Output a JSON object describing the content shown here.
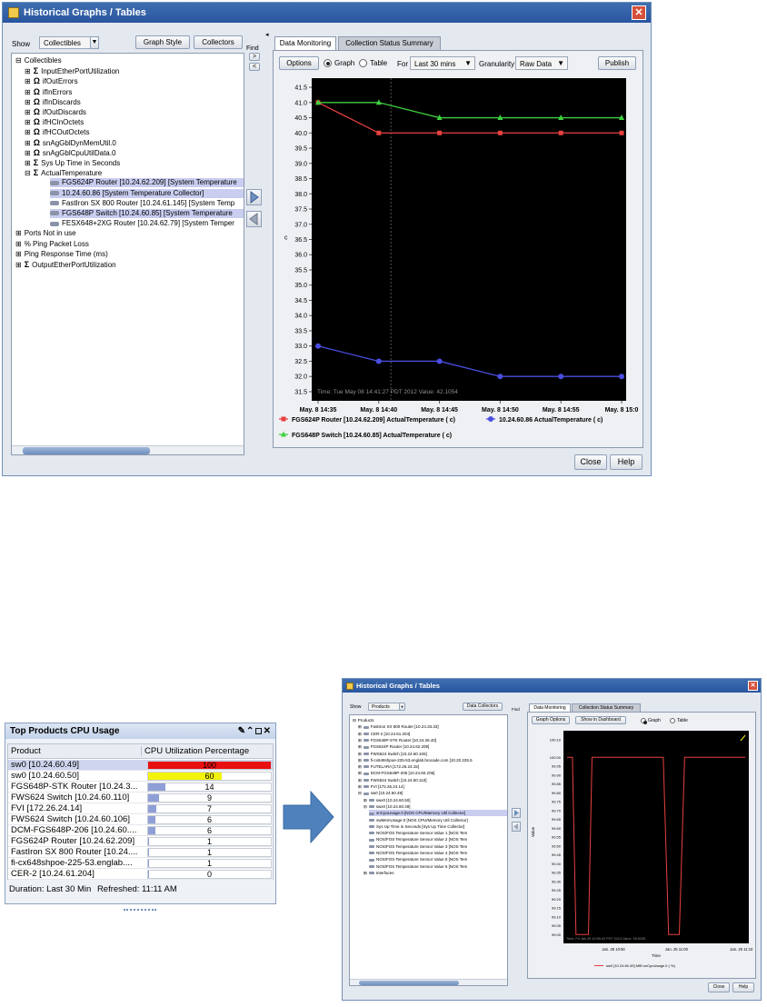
{
  "main_window": {
    "title": "Historical Graphs / Tables",
    "show_label": "Show",
    "show_value": "Collectibles",
    "graph_style_label": "Graph Style",
    "collectors_label": "Collectors",
    "find_label": "Find",
    "tree": [
      {
        "depth": 0,
        "exp": "⊟",
        "icon": "",
        "label": "Collectibles",
        "selected": false
      },
      {
        "depth": 1,
        "exp": "⊞",
        "icon": "Σ",
        "label": "InputEtherPortUtilization",
        "selected": false
      },
      {
        "depth": 1,
        "exp": "⊞",
        "icon": "Ω",
        "label": "ifOutErrors",
        "selected": false
      },
      {
        "depth": 1,
        "exp": "⊞",
        "icon": "Ω",
        "label": "ifInErrors",
        "selected": false
      },
      {
        "depth": 1,
        "exp": "⊞",
        "icon": "Ω",
        "label": "ifInDiscards",
        "selected": false
      },
      {
        "depth": 1,
        "exp": "⊞",
        "icon": "Ω",
        "label": "ifOutDiscards",
        "selected": false
      },
      {
        "depth": 1,
        "exp": "⊞",
        "icon": "Ω",
        "label": "ifHCInOctets",
        "selected": false
      },
      {
        "depth": 1,
        "exp": "⊞",
        "icon": "Ω",
        "label": "ifHCOutOctets",
        "selected": false
      },
      {
        "depth": 1,
        "exp": "⊞",
        "icon": "Ω",
        "label": "snAgGblDynMemUtil.0",
        "selected": false
      },
      {
        "depth": 1,
        "exp": "⊞",
        "icon": "Ω",
        "label": "snAgGblCpuUtilData.0",
        "selected": false
      },
      {
        "depth": 1,
        "exp": "⊞",
        "icon": "Σ",
        "label": "Sys Up Time in Seconds",
        "selected": false
      },
      {
        "depth": 1,
        "exp": "⊟",
        "icon": "Σ",
        "label": "ActualTemperature",
        "selected": false
      },
      {
        "depth": 2,
        "exp": "",
        "icon": "dev",
        "label": "FGS624P Router [10.24.62.209] [System Temperature",
        "selected": true
      },
      {
        "depth": 2,
        "exp": "",
        "icon": "dev",
        "label": "10.24.60.86 [System Temperature Collector]",
        "selected": true
      },
      {
        "depth": 2,
        "exp": "",
        "icon": "dev",
        "label": "FastIron SX 800 Router [10.24.61.145] [System Temp",
        "selected": false
      },
      {
        "depth": 2,
        "exp": "",
        "icon": "dev",
        "label": "FGS648P Switch [10.24.60.85] [System Temperature",
        "selected": true
      },
      {
        "depth": 2,
        "exp": "",
        "icon": "dev",
        "label": "FESX648+2XG Router [10.24.62.79] [System Temper",
        "selected": false
      },
      {
        "depth": 0,
        "exp": "⊞",
        "icon": "",
        "label": "Ports Not in use",
        "selected": false
      },
      {
        "depth": 0,
        "exp": "⊞",
        "icon": "",
        "label": "% Ping Packet Loss",
        "selected": false
      },
      {
        "depth": 0,
        "exp": "⊞",
        "icon": "",
        "label": "Ping Response Time (ms)",
        "selected": false
      },
      {
        "depth": 0,
        "exp": "⊞",
        "icon": "Σ",
        "label": "OutputEtherPortUtilization",
        "selected": false
      }
    ],
    "tabs": [
      "Data Monitoring",
      "Collection Status Summary"
    ],
    "options_label": "Options",
    "graph_label": "Graph",
    "table_label": "Table",
    "for_label": "For",
    "for_value": "Last 30 mins",
    "granularity_label": "Granularity",
    "granularity_value": "Raw Data",
    "publish_label": "Publish",
    "tooltip": "Time: Tue May 08 14:41:27 PDT 2012 Value: 42.1054",
    "close_label": "Close",
    "help_label": "Help"
  },
  "chart_data": [
    {
      "type": "line",
      "ylabel": "c",
      "ylim": [
        31.2,
        41.8
      ],
      "yticks": [
        "41.5",
        "41.0",
        "40.5",
        "40.0",
        "39.5",
        "39.0",
        "38.5",
        "38.0",
        "37.5",
        "37.0",
        "36.5",
        "36.0",
        "35.5",
        "35.0",
        "34.5",
        "34.0",
        "33.5",
        "33.0",
        "32.5",
        "32.0",
        "31.5"
      ],
      "categories": [
        "May. 8 14:35",
        "May. 8 14:40",
        "May. 8 14:45",
        "May. 8 14:50",
        "May. 8 14:55",
        "May. 8 15:0"
      ],
      "x": [
        0,
        1,
        2,
        3,
        4,
        5
      ],
      "grid": false,
      "legend_position": "bottom",
      "series": [
        {
          "name": "FGS624P Router [10.24.62.209] ActualTemperature ( c)",
          "color": "#e84040",
          "marker": "square",
          "values": [
            41.0,
            40.0,
            40.0,
            40.0,
            40.0,
            40.0
          ]
        },
        {
          "name": "10.24.60.86 ActualTemperature ( c)",
          "color": "#4a4ee0",
          "marker": "circle",
          "values": [
            33.0,
            32.5,
            32.5,
            32.0,
            32.0,
            32.0
          ]
        },
        {
          "name": "FGS648P Switch [10.24.60.85] ActualTemperature ( c)",
          "color": "#3fd040",
          "marker": "triangle",
          "values": [
            41.0,
            41.0,
            40.5,
            40.5,
            40.5,
            40.5
          ]
        }
      ]
    },
    {
      "type": "table",
      "title": "Top Products CPU Usage",
      "columns": [
        "Product",
        "CPU Utilization Percentage"
      ],
      "rows": [
        {
          "product": "sw0 [10.24.60.49]",
          "value": 100,
          "color": "#e81010"
        },
        {
          "product": "sw0 [10.24.60.50]",
          "value": 60,
          "color": "#f2f20a"
        },
        {
          "product": "FGS648P-STK Router [10.24.3...",
          "value": 14,
          "color": "#8f9fd6"
        },
        {
          "product": "FWS624 Switch [10.24.60.110]",
          "value": 9,
          "color": "#8f9fd6"
        },
        {
          "product": "FVI [172.26.24.14]",
          "value": 7,
          "color": "#8f9fd6"
        },
        {
          "product": "FWS624 Switch [10.24.60.106]",
          "value": 6,
          "color": "#8f9fd6"
        },
        {
          "product": "DCM-FGS648P-206 [10.24.60....",
          "value": 6,
          "color": "#8f9fd6"
        },
        {
          "product": "FGS624P Router [10.24.62.209]",
          "value": 1,
          "color": "#8f9fd6"
        },
        {
          "product": "FastIron SX 800 Router [10.24....",
          "value": 1,
          "color": "#8f9fd6"
        },
        {
          "product": "fi-cx648shpoe-225-53.englab....",
          "value": 1,
          "color": "#8f9fd6"
        },
        {
          "product": "CER-2 [10.24.61.204]",
          "value": 0,
          "color": "#8f9fd6"
        }
      ]
    },
    {
      "type": "line",
      "xlabel": "Time",
      "ylabel": "Value",
      "ylim": [
        98.95,
        100.15
      ],
      "yticks": [
        "100.10",
        "100.00",
        "99.95",
        "99.90",
        "99.85",
        "99.80",
        "99.75",
        "99.70",
        "99.65",
        "99.60",
        "99.55",
        "99.50",
        "99.45",
        "99.40",
        "99.35",
        "99.30",
        "99.25",
        "99.20",
        "99.15",
        "99.10",
        "99.05",
        "99.00"
      ],
      "categories": [
        "Jan. 25 10:50",
        "Jan. 25 11:00",
        "Jan. 25 11:10"
      ],
      "legend_position": "bottom",
      "series": [
        {
          "name": "sw0 [10.24.60.49] MIB snCpuUsage.0 ( %)",
          "color": "#e84040",
          "values": [
            {
              "t": 0.0,
              "v": 100.0
            },
            {
              "t": 0.03,
              "v": 100.0
            },
            {
              "t": 0.05,
              "v": 99.0
            },
            {
              "t": 0.12,
              "v": 99.0
            },
            {
              "t": 0.14,
              "v": 100.0
            },
            {
              "t": 0.54,
              "v": 100.0
            },
            {
              "t": 0.57,
              "v": 99.0
            },
            {
              "t": 0.63,
              "v": 99.0
            },
            {
              "t": 0.66,
              "v": 100.0
            },
            {
              "t": 1.0,
              "v": 100.0
            }
          ]
        }
      ]
    }
  ],
  "widget": {
    "duration_label": "Duration: Last 30 Min",
    "refreshed_label": "Refreshed: 11:11 AM",
    "controls": "✎⌃◻✕"
  },
  "small_window": {
    "title": "Historical Graphs / Tables",
    "show_label": "Show",
    "show_value": "Products",
    "data_collectors_label": "Data Collectors",
    "find_label": "Find",
    "tree": [
      {
        "depth": 0,
        "exp": "⊟",
        "label": "Products",
        "selected": false
      },
      {
        "depth": 1,
        "exp": "⊞",
        "label": "FastIron SX 800 Router [10.24.33.33]",
        "selected": false
      },
      {
        "depth": 1,
        "exp": "⊞",
        "label": "CER-2 [10.24.61.204]",
        "selected": false
      },
      {
        "depth": 1,
        "exp": "⊞",
        "label": "FGS648P-STK Router [10.24.36.40]",
        "selected": false
      },
      {
        "depth": 1,
        "exp": "⊞",
        "label": "FGS624P Router [10.24.62.209]",
        "selected": false
      },
      {
        "depth": 1,
        "exp": "⊞",
        "label": "FWS624 Switch [10.24.60.106]",
        "selected": false
      },
      {
        "depth": 1,
        "exp": "⊞",
        "label": "fi-cx648shpoe-225-53.englab.brocade.com [10.20.225.5",
        "selected": false
      },
      {
        "depth": 1,
        "exp": "⊞",
        "label": "FUTELARA [172.26.24.15]",
        "selected": false
      },
      {
        "depth": 1,
        "exp": "⊞",
        "label": "DCM-FGS648P-206 [10.24.60.206]",
        "selected": false
      },
      {
        "depth": 1,
        "exp": "⊞",
        "label": "FWS624 Switch [10.24.60.110]",
        "selected": false
      },
      {
        "depth": 1,
        "exp": "⊞",
        "label": "FVI [172.26.24.14]",
        "selected": false
      },
      {
        "depth": 1,
        "exp": "⊟",
        "label": "sw0 [10.24.60.49]",
        "selected": false
      },
      {
        "depth": 2,
        "exp": "⊞",
        "label": "swx0 [10.24.60.50]",
        "selected": false
      },
      {
        "depth": 2,
        "exp": "⊟",
        "label": "swx0 [10.24.60.49]",
        "selected": false
      },
      {
        "depth": 3,
        "exp": "",
        "label": "snCpuUsage.0 [NOS CPU/Memory Util Collector]",
        "selected": true
      },
      {
        "depth": 3,
        "exp": "",
        "label": "swMemUsage.0 [NOS CPU/Memory Util Collector]",
        "selected": false
      },
      {
        "depth": 3,
        "exp": "",
        "label": "Sys Up Time in Seconds [Sys Up Time Collector]",
        "selected": false
      },
      {
        "depth": 3,
        "exp": "",
        "label": "NOS/FOS Temperature Sensor Value 1 [NOS Tem",
        "selected": false
      },
      {
        "depth": 3,
        "exp": "",
        "label": "NOS/FOS Temperature Sensor Value 2 [NOS Tem",
        "selected": false
      },
      {
        "depth": 3,
        "exp": "",
        "label": "NOS/FOS Temperature Sensor Value 3 [NOS Tem",
        "selected": false
      },
      {
        "depth": 3,
        "exp": "",
        "label": "NOS/FOS Temperature Sensor Value 4 [NOS Tem",
        "selected": false
      },
      {
        "depth": 3,
        "exp": "",
        "label": "NOS/FOS Temperature Sensor Value 5 [NOS Tem",
        "selected": false
      },
      {
        "depth": 3,
        "exp": "",
        "label": "NOS/FOS Temperature Sensor Value 6 [NOS Tem",
        "selected": false
      },
      {
        "depth": 2,
        "exp": "⊞",
        "label": "Interfaces",
        "selected": false
      }
    ],
    "tabs": [
      "Data Monitoring",
      "Collection Status Summary"
    ],
    "graph_options_label": "Graph Options",
    "show_in_dashboard_label": "Show in Dashboard",
    "graph_label": "Graph",
    "table_label": "Table",
    "tooltip": "Time: Fri Jan 25 10:59:42 PST 2013 Value: 99.6335",
    "close_label": "Close",
    "help_label": "Help"
  },
  "colors": {
    "title_blue": "#2a55a0",
    "chart_bg": "#000000",
    "selection": "#c9cdf0",
    "arrow_blue": "#3d72c8"
  }
}
